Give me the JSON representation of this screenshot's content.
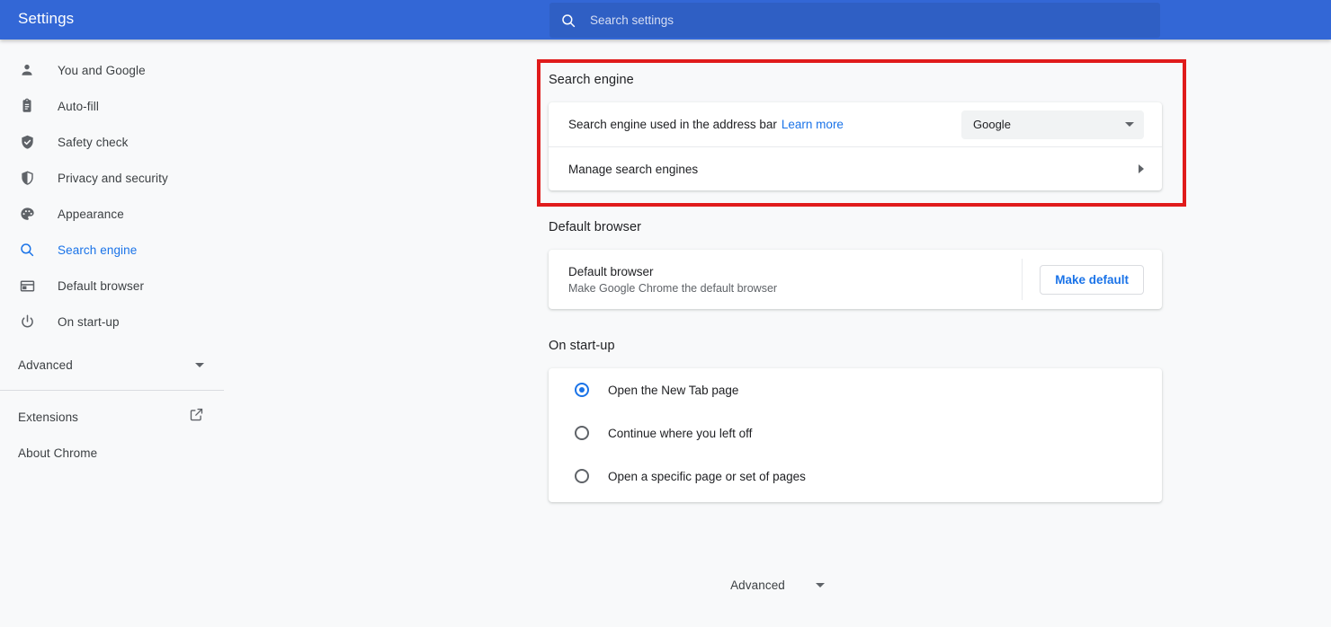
{
  "header": {
    "title": "Settings",
    "search": {
      "icon": "search-icon",
      "placeholder": "Search settings",
      "value": ""
    }
  },
  "sidebar": {
    "items": [
      {
        "label": "You and Google",
        "icon": "person-icon",
        "active": false
      },
      {
        "label": "Auto-fill",
        "icon": "clipboard-icon",
        "active": false
      },
      {
        "label": "Safety check",
        "icon": "shield-check-icon",
        "active": false
      },
      {
        "label": "Privacy and security",
        "icon": "shield-half-icon",
        "active": false
      },
      {
        "label": "Appearance",
        "icon": "palette-icon",
        "active": false
      },
      {
        "label": "Search engine",
        "icon": "search-icon",
        "active": true
      },
      {
        "label": "Default browser",
        "icon": "browser-window-icon",
        "active": false
      },
      {
        "label": "On start-up",
        "icon": "power-icon",
        "active": false
      }
    ],
    "advanced": {
      "label": "Advanced",
      "icon": "chevron-down-icon"
    },
    "extensions": {
      "label": "Extensions",
      "icon": "external-link-icon"
    },
    "about": {
      "label": "About Chrome"
    }
  },
  "main": {
    "search_engine": {
      "title": "Search engine",
      "address_bar_row": {
        "label": "Search engine used in the address bar",
        "link": "Learn more",
        "select_value": "Google",
        "select_icon": "chevron-down-icon"
      },
      "manage_row": {
        "label": "Manage search engines",
        "icon": "chevron-right-icon"
      }
    },
    "default_browser": {
      "title": "Default browser",
      "row_label": "Default browser",
      "row_sub": "Make Google Chrome the default browser",
      "button": "Make default"
    },
    "on_startup": {
      "title": "On start-up",
      "options": [
        {
          "label": "Open the New Tab page",
          "selected": true
        },
        {
          "label": "Continue where you left off",
          "selected": false
        },
        {
          "label": "Open a specific page or set of pages",
          "selected": false
        }
      ]
    },
    "advanced_footer": {
      "label": "Advanced",
      "icon": "chevron-down-icon"
    }
  },
  "annotations": {
    "highlight_color": "#e01b1b",
    "highlight_target": "search-engine-section"
  },
  "colors": {
    "header_blue": "#3367d6",
    "accent_blue": "#1a73e8",
    "page_bg": "#f8f9fa",
    "card_bg": "#ffffff",
    "text_primary": "#202124",
    "text_secondary": "#5f6368"
  }
}
